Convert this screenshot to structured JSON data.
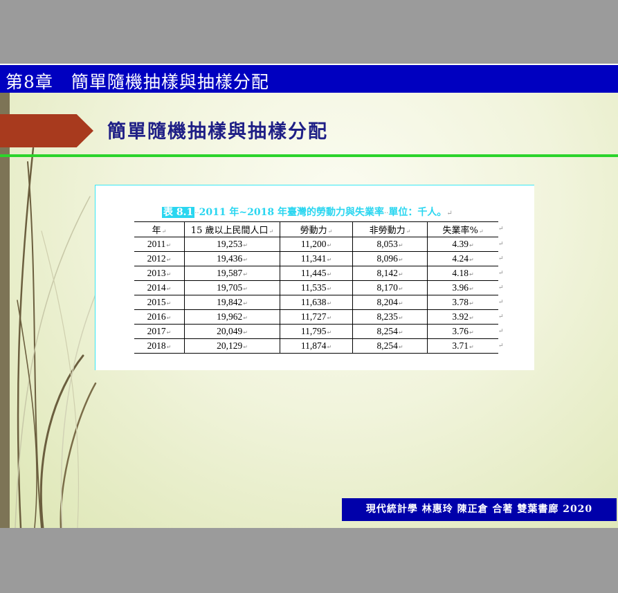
{
  "chapter_header": "第8章　簡單隨機抽樣與抽樣分配",
  "slide_title": "簡單隨機抽樣與抽樣分配",
  "table": {
    "caption_label": "表 8.1",
    "caption_text": "2011 年~2018 年臺灣的勞動力與失業率",
    "caption_unit": "單位：千人。",
    "headers": [
      "年",
      "15 歲以上民間人口",
      "勞動力",
      "非勞動力",
      "失業率%"
    ],
    "rows": [
      [
        "2011",
        "19,253",
        "11,200",
        "8,053",
        "4.39"
      ],
      [
        "2012",
        "19,436",
        "11,341",
        "8,096",
        "4.24"
      ],
      [
        "2013",
        "19,587",
        "11,445",
        "8,142",
        "4.18"
      ],
      [
        "2014",
        "19,705",
        "11,535",
        "8,170",
        "3.96"
      ],
      [
        "2015",
        "19,842",
        "11,638",
        "8,204",
        "3.78"
      ],
      [
        "2016",
        "19,962",
        "11,727",
        "8,235",
        "3.92"
      ],
      [
        "2017",
        "20,049",
        "11,795",
        "8,254",
        "3.76"
      ],
      [
        "2018",
        "20,129",
        "11,874",
        "8,254",
        "3.71"
      ]
    ]
  },
  "footer": "現代統計學 林惠玲 陳正倉 合著 雙葉書廊 2020",
  "colors": {
    "chapter_bar": "#0000c0",
    "title_text": "#1f1f86",
    "accent_arrow": "#a83a1e",
    "green_rule": "#2bd42b",
    "caption_cyan": "#2ad6f0",
    "footer_bar": "#0000aa"
  }
}
